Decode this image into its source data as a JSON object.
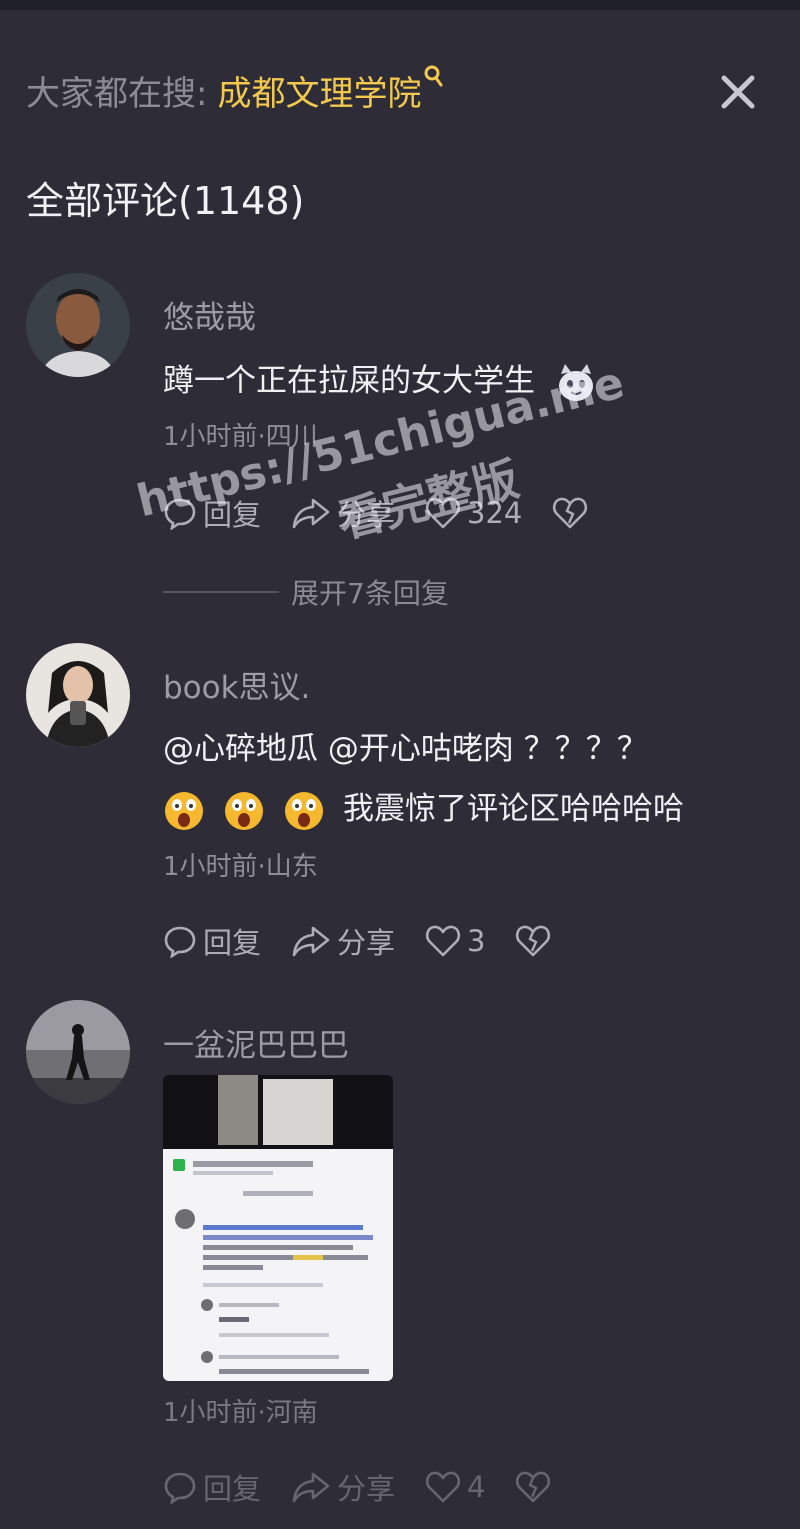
{
  "search": {
    "label": "大家都在搜:",
    "term": "成都文理学院"
  },
  "comments_title": "全部评论(1148)",
  "comments": [
    {
      "username": "悠哉哉",
      "text": "蹲一个正在拉屎的女大学生",
      "meta": "1小时前·四川",
      "reply_label": "回复",
      "share_label": "分享",
      "like_count": "324",
      "replies_toggle": "展开7条回复"
    },
    {
      "username": "book思议.",
      "line1": "@心碎地瓜  @开心咕咾肉 ？？？？",
      "line2": "我震惊了评论区哈哈哈哈",
      "meta": "1小时前·山东",
      "reply_label": "回复",
      "share_label": "分享",
      "like_count": "3"
    },
    {
      "username": "一盆泥巴巴巴",
      "meta": "1小时前·河南",
      "reply_label": "回复",
      "share_label": "分享",
      "like_count": "4"
    }
  ],
  "watermark": {
    "url": "https://51chigua.me",
    "caption": "看完整版"
  },
  "colors": {
    "background": "#2d2c37",
    "accent": "#f2c94c",
    "muted_text": "#8f8e98"
  }
}
